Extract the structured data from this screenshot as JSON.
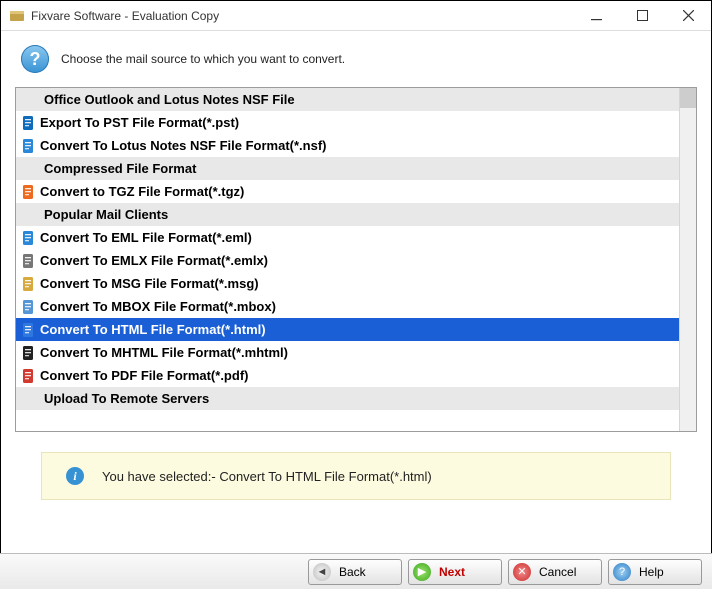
{
  "window": {
    "title": "Fixvare Software - Evaluation Copy"
  },
  "instruction": "Choose the mail source to which you want to convert.",
  "list": {
    "items": [
      {
        "type": "header",
        "label": "Office Outlook and Lotus Notes NSF File"
      },
      {
        "type": "item",
        "label": "Export To PST File Format(*.pst)",
        "icon": "outlook-icon",
        "color": "#0f6cbd"
      },
      {
        "type": "item",
        "label": "Convert To Lotus Notes NSF File Format(*.nsf)",
        "icon": "lotus-icon",
        "color": "#2a88d8"
      },
      {
        "type": "header",
        "label": "Compressed File Format"
      },
      {
        "type": "item",
        "label": "Convert to TGZ File Format(*.tgz)",
        "icon": "tgz-icon",
        "color": "#ed6b1f"
      },
      {
        "type": "header",
        "label": "Popular Mail Clients"
      },
      {
        "type": "item",
        "label": "Convert To EML File Format(*.eml)",
        "icon": "eml-icon",
        "color": "#2a88d8"
      },
      {
        "type": "item",
        "label": "Convert To EMLX File Format(*.emlx)",
        "icon": "emlx-icon",
        "color": "#777777"
      },
      {
        "type": "item",
        "label": "Convert To MSG File Format(*.msg)",
        "icon": "msg-icon",
        "color": "#d8a93c"
      },
      {
        "type": "item",
        "label": "Convert To MBOX File Format(*.mbox)",
        "icon": "mbox-icon",
        "color": "#5596d6"
      },
      {
        "type": "item",
        "label": "Convert To HTML File Format(*.html)",
        "icon": "html-icon",
        "color": "#2f78e0",
        "selected": true
      },
      {
        "type": "item",
        "label": "Convert To MHTML File Format(*.mhtml)",
        "icon": "mhtml-icon",
        "color": "#222222"
      },
      {
        "type": "item",
        "label": "Convert To PDF File Format(*.pdf)",
        "icon": "pdf-icon",
        "color": "#d33a2f"
      },
      {
        "type": "header",
        "label": "Upload To Remote Servers"
      }
    ]
  },
  "status": {
    "prefix": "You have selected:- ",
    "selection": "Convert To HTML File Format(*.html)"
  },
  "buttons": {
    "back": "Back",
    "next": "Next",
    "cancel": "Cancel",
    "help": "Help"
  }
}
